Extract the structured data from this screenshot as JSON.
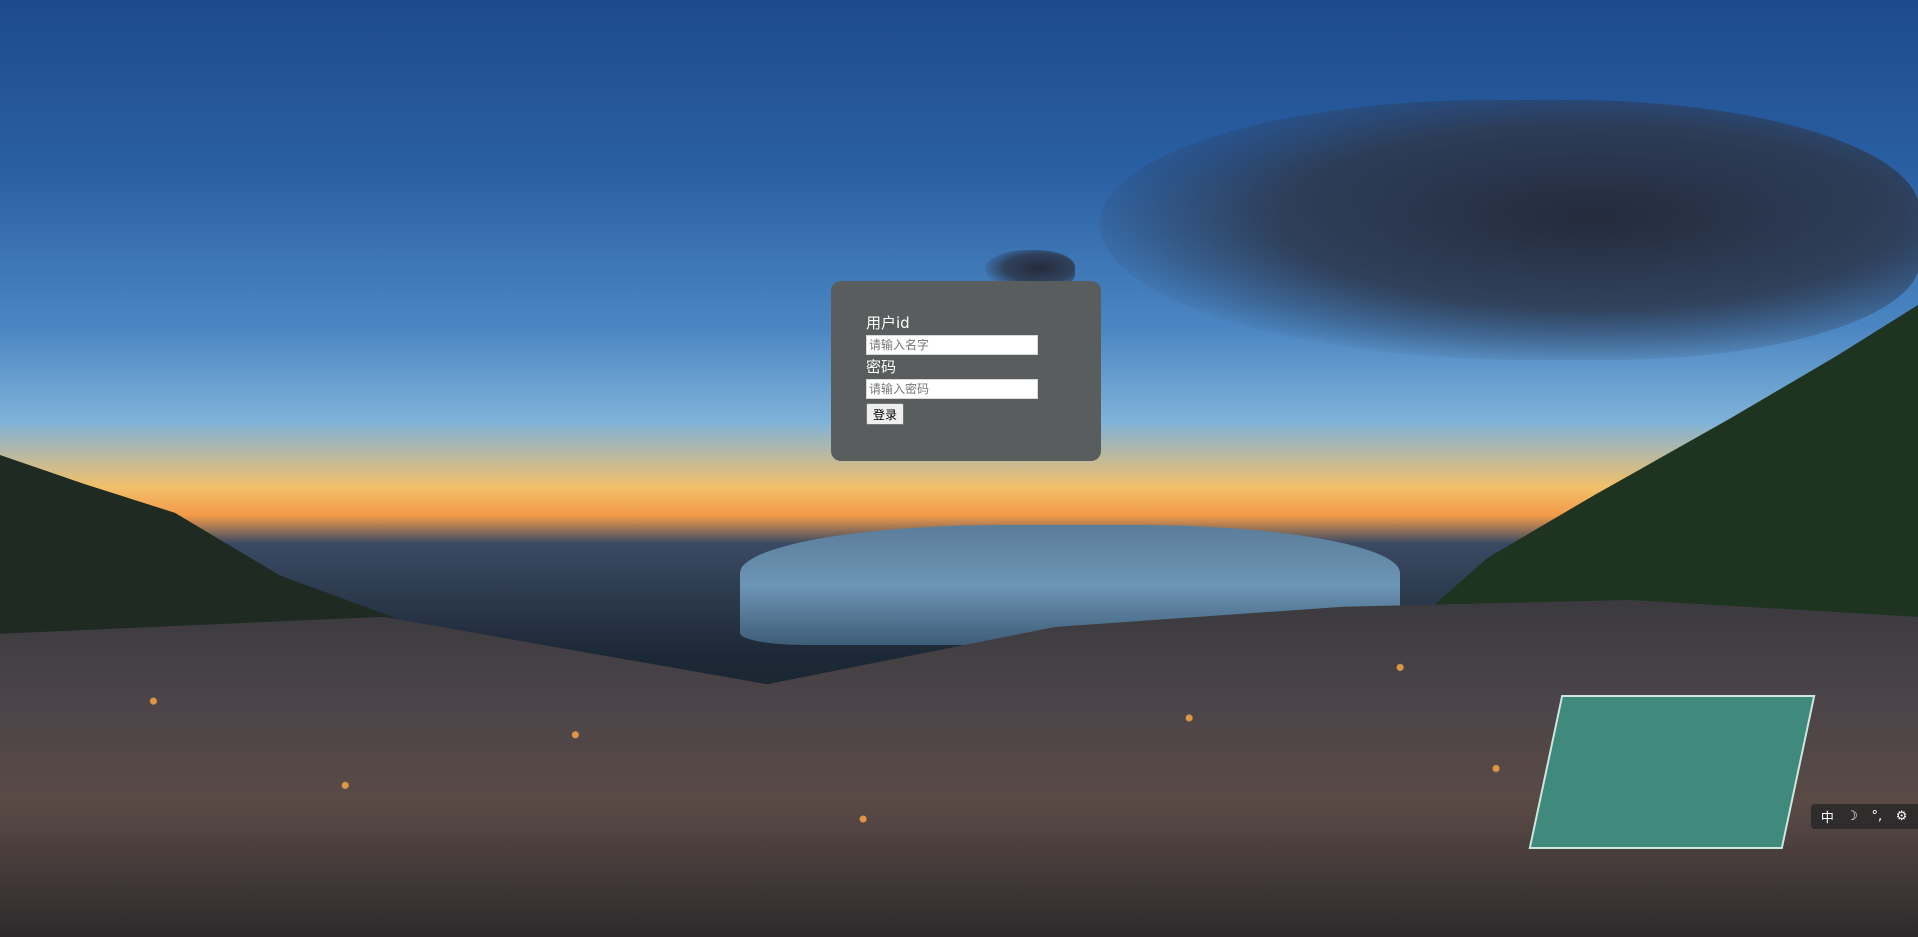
{
  "login": {
    "user_label": "用户id",
    "user_placeholder": "请输入名字",
    "user_value": "",
    "password_label": "密码",
    "password_placeholder": "请输入密码",
    "password_value": "",
    "submit_label": "登录"
  },
  "ime_toolbar": {
    "language": "中",
    "icons": [
      "moon-icon",
      "punctuation-icon",
      "settings-icon"
    ],
    "moon_glyph": "☽",
    "punct_glyph": "°,",
    "settings_glyph": "⚙"
  },
  "background": {
    "sky_top": "#1d4a8a",
    "horizon": "#f39a4a",
    "panel_color": "#5a5d5d"
  }
}
